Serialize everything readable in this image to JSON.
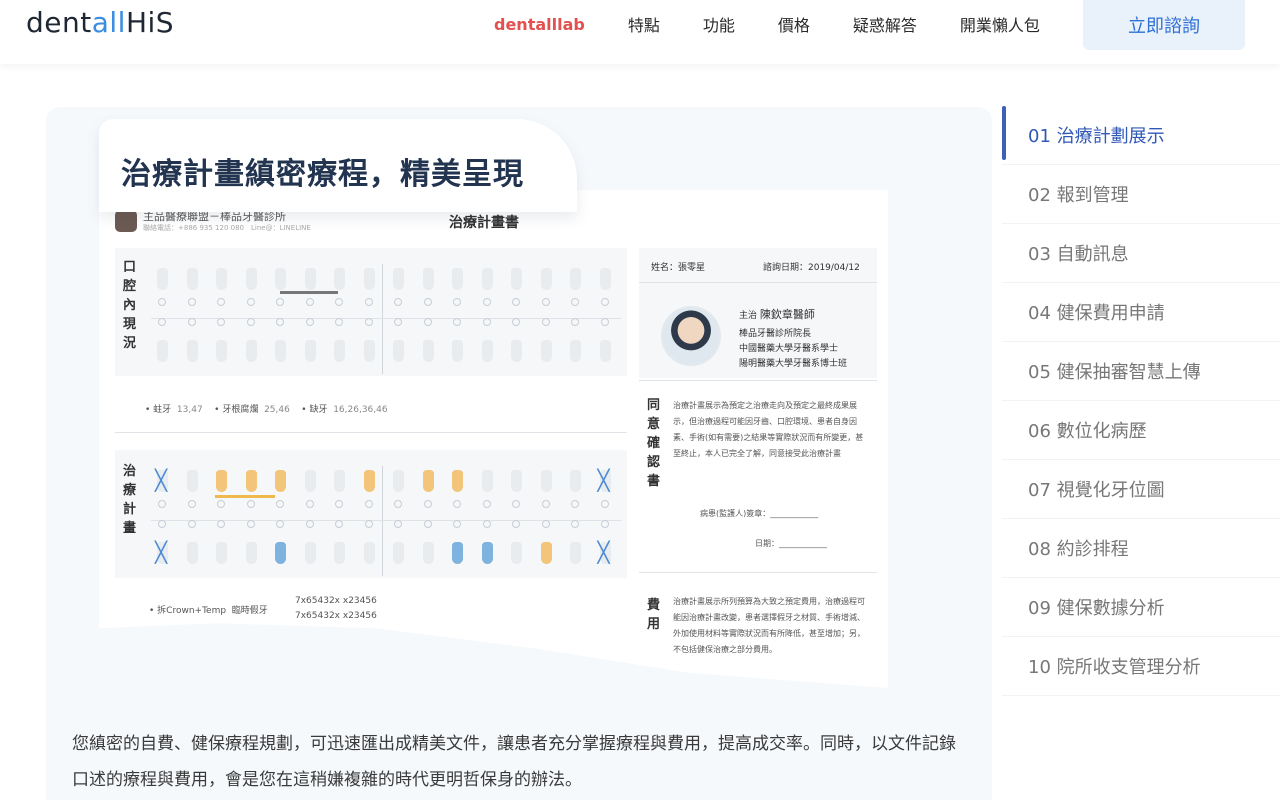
{
  "header": {
    "logo_dark": "dent",
    "logo_blue": "all",
    "logo_tail": "HiS",
    "nav": [
      "dentalllab",
      "特點",
      "功能",
      "價格",
      "疑惑解答",
      "開業懶人包"
    ],
    "cta": "立即諮詢"
  },
  "card": {
    "title": "治療計畫縝密療程，精美呈現",
    "body": "您縝密的自費、健保療程規劃，可迅速匯出成精美文件，讓患者充分掌握療程與費用，提高成交率。同時，以文件記錄口述的療程與費用，會是您在這稍嫌複雜的時代更明哲保身的辦法。"
  },
  "doc": {
    "title": "治療計畫書",
    "clinic": "主品醫療聯盟－棒品牙醫診所",
    "clinic_sub": "聯絡電話：+886 935 120 080　Line@：LINELINE",
    "section_oral": "口腔內現況",
    "section_plan": "治療計畫",
    "legend_oral": [
      {
        "label": "蛀牙",
        "value": "13,47"
      },
      {
        "label": "牙根腐爛",
        "value": "25,46"
      },
      {
        "label": "缺牙",
        "value": "16,26,36,46"
      }
    ],
    "legend_plan_label": "拆Crown+Temp",
    "legend_plan_value": "臨時假牙",
    "legend_plan_code1": "7x65432x x23456",
    "legend_plan_code2": "7x65432x x23456",
    "patient": "姓名：張零星",
    "consult_date": "諮詢日期：2019/04/12",
    "doctor_role": "主治",
    "doctor_name": "陳欽章醫師",
    "doctor_lines": [
      "棒品牙醫診所院長",
      "中國醫藥大學牙醫系學士",
      "陽明醫藥大學牙醫系博士班"
    ],
    "consent_label": "同意確認書",
    "consent_text": "治療計畫展示為預定之治療走向及預定之最終成果展示，但治療過程可能因牙齒、口腔環境、患者自身因素、手術(如有需要)之結果等實際狀況而有所變更，甚至終止，本人已完全了解，同意接受此治療計畫",
    "sign_patient": "病患(監護人)簽章：",
    "sign_date": "日期：",
    "fee_label": "費用",
    "fee_text": "治療計畫展示所列預算為大致之預定費用，治療過程可能因治療計畫改變，患者選擇假牙之材質、手術增減、外加使用材料等實際狀況而有所降低，甚至增加；另，不包括健保治療之部分費用。"
  },
  "toc": [
    "01 治療計劃展示",
    "02 報到管理",
    "03 自動訊息",
    "04 健保費用申請",
    "05 健保抽審智慧上傳",
    "06 數位化病歷",
    "07 視覺化牙位圖",
    "08 約診排程",
    "09 健保數據分析",
    "10 院所收支管理分析"
  ]
}
